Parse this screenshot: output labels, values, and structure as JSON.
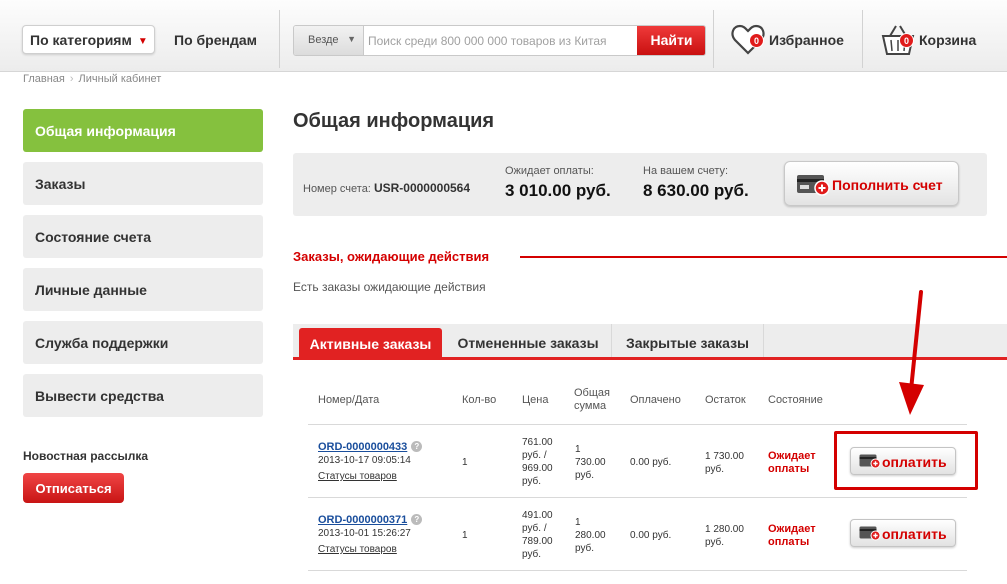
{
  "header": {
    "category_button": "По категориям",
    "brands_link": "По брендам",
    "search_scope": "Везде",
    "search_placeholder": "Поиск среди 800 000 000 товаров из Китая",
    "search_button": "Найти",
    "favorites_label": "Избранное",
    "favorites_count": "0",
    "cart_label": "Корзина",
    "cart_count": "0"
  },
  "breadcrumb": [
    "Главная",
    "Личный кабинет"
  ],
  "sidebar": {
    "items": [
      {
        "label": "Общая информация",
        "active": true
      },
      {
        "label": "Заказы"
      },
      {
        "label": "Состояние счета"
      },
      {
        "label": "Личные данные"
      },
      {
        "label": "Служба поддержки"
      },
      {
        "label": "Вывести средства"
      }
    ],
    "newsletter_label": "Новостная рассылка",
    "unsubscribe_button": "Отписаться"
  },
  "main": {
    "title": "Общая информация",
    "account": {
      "number_label": "Номер счета:",
      "number": "USR-0000000564",
      "awaiting_label": "Ожидает оплаты:",
      "awaiting_value": "3 010.00 руб.",
      "balance_label": "На вашем счету:",
      "balance_value": "8 630.00 руб.",
      "topup_button": "Пополнить счет"
    },
    "section_title": "Заказы, ожидающие действия",
    "section_desc": "Есть заказы ожидающие действия",
    "tabs": [
      {
        "label": "Активные заказы",
        "active": true
      },
      {
        "label": "Отмененные заказы"
      },
      {
        "label": "Закрытые заказы"
      }
    ],
    "table": {
      "headers": [
        "Номер/Дата",
        "Кол-во",
        "Цена",
        "Общая сумма",
        "Оплачено",
        "Остаток",
        "Состояние"
      ],
      "rows": [
        {
          "order": "ORD-0000000433",
          "date": "2013-10-17 09:05:14",
          "statuses_link": "Статусы товаров",
          "qty": "1",
          "price": "761.00 руб. / 969.00 руб.",
          "total": "1 730.00 руб.",
          "paid": "0.00 руб.",
          "remaining": "1 730.00 руб.",
          "state": "Ожидает оплаты",
          "pay_button": "оплатить"
        },
        {
          "order": "ORD-0000000371",
          "date": "2013-10-01 15:26:27",
          "statuses_link": "Статусы товаров",
          "qty": "1",
          "price": "491.00 руб. / 789.00 руб.",
          "total": "1 280.00 руб.",
          "paid": "0.00 руб.",
          "remaining": "1 280.00 руб.",
          "state": "Ожидает оплаты",
          "pay_button": "оплатить"
        }
      ]
    }
  },
  "colors": {
    "accent_red": "#d40000",
    "active_green": "#85c13e",
    "link_blue": "#1a4e9c"
  },
  "icons": [
    "heart-icon",
    "basket-icon",
    "credit-card-icon",
    "question-icon",
    "arrow-down-icon"
  ]
}
